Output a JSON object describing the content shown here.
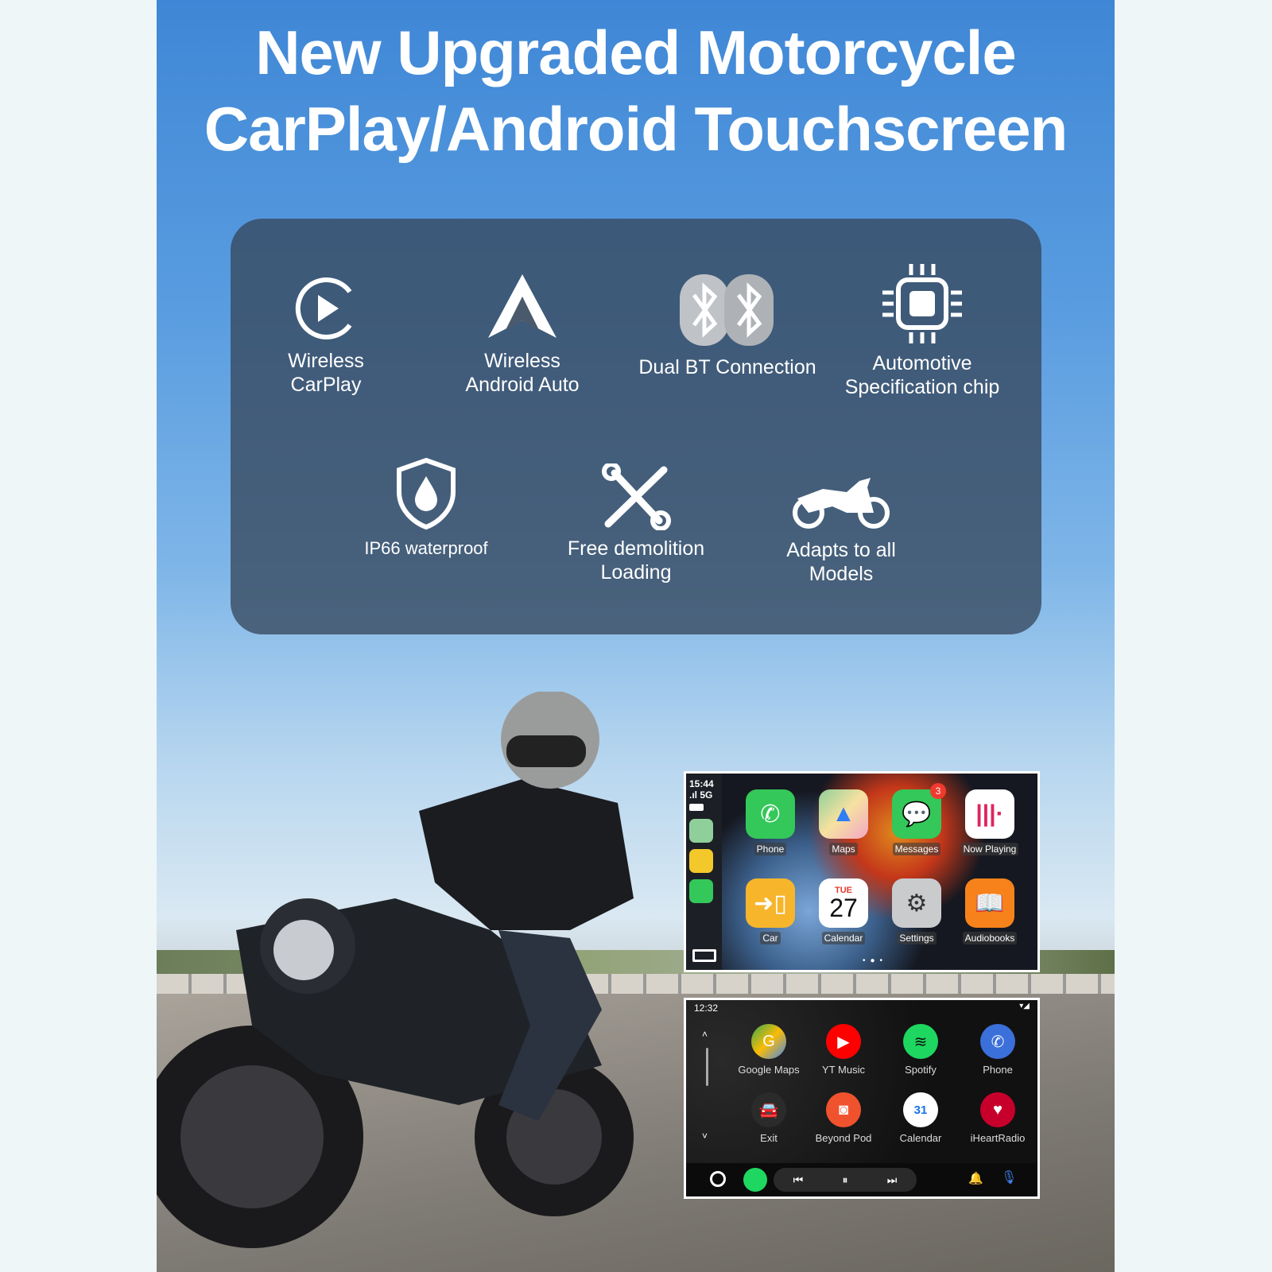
{
  "title": {
    "line1": "New Upgraded Motorcycle",
    "line2": "CarPlay/Android Touchscreen"
  },
  "features": [
    {
      "icon": "carplay-icon",
      "line1": "Wireless",
      "line2": "CarPlay"
    },
    {
      "icon": "android-auto-icon",
      "line1": "Wireless",
      "line2": "Android Auto"
    },
    {
      "icon": "bluetooth-icon",
      "line1": "Dual BT Connection",
      "line2": ""
    },
    {
      "icon": "chip-icon",
      "line1": "Automotive",
      "line2": "Specification chip"
    },
    {
      "icon": "waterproof-shield-icon",
      "line1": "IP66  waterproof",
      "line2": ""
    },
    {
      "icon": "tools-icon",
      "line1": "Free demolition",
      "line2": "Loading"
    },
    {
      "icon": "motorcycle-icon",
      "line1": "Adapts to all",
      "line2": "Models"
    }
  ],
  "carplay": {
    "time": "15:44",
    "signal": "5G",
    "badge": "3",
    "calendar_day": "TUE",
    "calendar_date": "27",
    "apps": [
      "Phone",
      "Maps",
      "Messages",
      "Now Playing",
      "Car",
      "Calendar",
      "Settings",
      "Audiobooks"
    ]
  },
  "android_auto": {
    "time": "12:32",
    "apps": [
      "Google Maps",
      "YT Music",
      "Spotify",
      "Phone",
      "Exit",
      "Beyond Pod",
      "Calendar",
      "iHeartRadio"
    ],
    "calendar_date": "31"
  },
  "colors": {
    "panel": "#37485c",
    "sky": "#3f87d6"
  }
}
